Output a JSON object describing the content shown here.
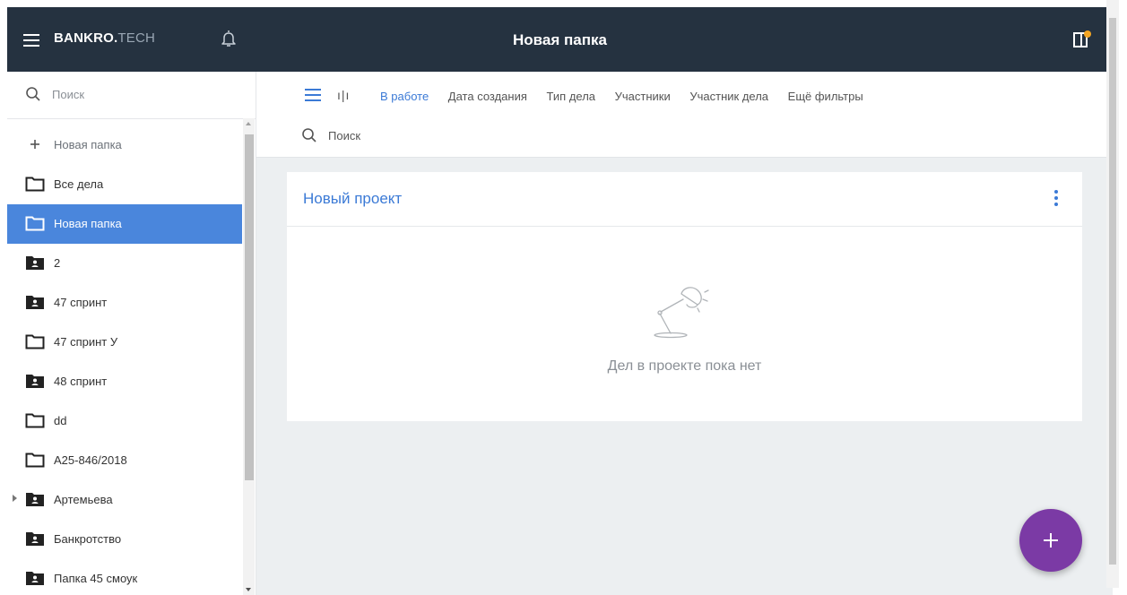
{
  "app": {
    "brand_bold": "BANKRO.",
    "brand_light": "TECH",
    "title": "Новая папка"
  },
  "sidebar": {
    "search_placeholder": "Поиск",
    "items": [
      {
        "label": "Новая папка",
        "icon": "plus-icon"
      },
      {
        "label": "Все дела",
        "icon": "folder-outline-icon"
      },
      {
        "label": "Новая папка",
        "icon": "folder-outline-icon",
        "active": true
      },
      {
        "label": "2",
        "icon": "folder-user-icon"
      },
      {
        "label": "47 спринт",
        "icon": "folder-user-icon"
      },
      {
        "label": "47 спринт У",
        "icon": "folder-outline-icon"
      },
      {
        "label": "48 спринт",
        "icon": "folder-user-icon"
      },
      {
        "label": "dd",
        "icon": "folder-outline-icon"
      },
      {
        "label": "А25-846/2018",
        "icon": "folder-outline-icon"
      },
      {
        "label": "Артемьева",
        "icon": "folder-user-icon",
        "expandable": true
      },
      {
        "label": "Банкротство",
        "icon": "folder-user-icon"
      },
      {
        "label": "Папка 45 смоук",
        "icon": "folder-user-icon"
      }
    ]
  },
  "toolbar": {
    "filters": [
      "В работе",
      "Дата создания",
      "Тип дела",
      "Участники",
      "Участник дела",
      "Ещё фильтры"
    ],
    "active_filter": "В работе",
    "search_placeholder": "Поиск"
  },
  "project": {
    "title": "Новый проект",
    "empty_text": "Дел в проекте пока нет"
  },
  "colors": {
    "topbar": "#253240",
    "accent": "#3b7ad6",
    "active_item": "#4a86dc",
    "fab": "#7b3aa5",
    "notification_dot": "#f5a623"
  }
}
